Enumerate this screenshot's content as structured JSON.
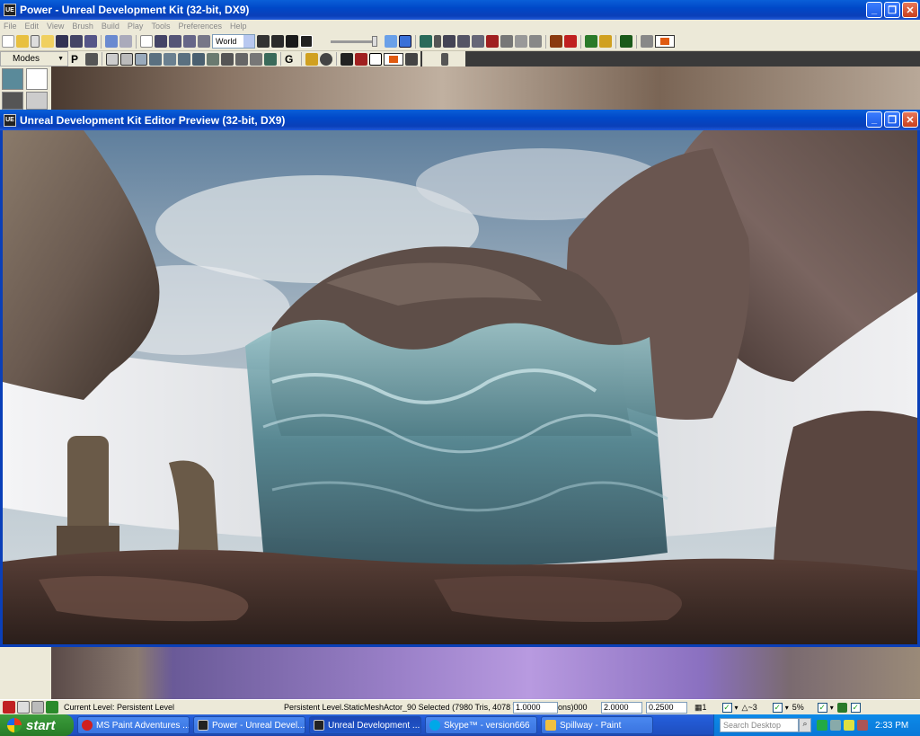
{
  "main_window": {
    "title": "Power - Unreal Development Kit (32-bit, DX9)",
    "app_icon": "UE"
  },
  "menu": [
    "File",
    "Edit",
    "View",
    "Brush",
    "Build",
    "Play",
    "Tools",
    "Preferences",
    "Help"
  ],
  "toolbar": {
    "coord_system": "World"
  },
  "modes_label": "Modes",
  "preview_window": {
    "title": "Unreal Development Kit Editor Preview (32-bit, DX9)"
  },
  "status_bar": {
    "current_level": "Current Level:  Persistent Level",
    "selection": "Persistent Level.StaticMeshActor_90 Selected (7980 Tris, 4078 Ve",
    "field_1": "1.0000",
    "field_1_suffix": "ons)000",
    "field_2": "2.0000",
    "field_3": "0.2500",
    "grid_value": "1",
    "angle_value": "3",
    "scale_value": "5%"
  },
  "taskbar": {
    "start_label": "start",
    "items": [
      {
        "label": "MS Paint Adventures ...",
        "icon_color": "#d02020"
      },
      {
        "label": "Power - Unreal Devel...",
        "icon_color": "#222222"
      },
      {
        "label": "Unreal Development ...",
        "icon_color": "#222222"
      },
      {
        "label": "Skype™ - version666",
        "icon_color": "#00a8e8"
      },
      {
        "label": "Spillway - Paint",
        "icon_color": "#f0c040"
      }
    ],
    "search_placeholder": "Search Desktop",
    "clock": "2:33 PM"
  },
  "colors": {
    "xp_blue": "#0048c8",
    "face": "#ece9d8",
    "accent_orange": "#e05a10"
  }
}
